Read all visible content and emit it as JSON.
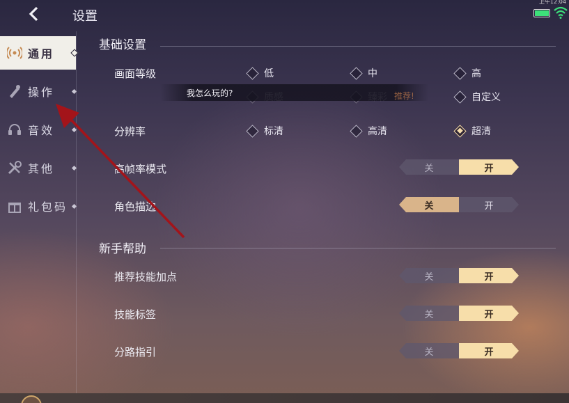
{
  "header": {
    "title": "设置",
    "time": "上午12:04"
  },
  "sidebar": {
    "items": [
      {
        "label": "通用",
        "icon": "radio-signal-icon",
        "active": true
      },
      {
        "label": "操作",
        "icon": "pen-icon",
        "active": false
      },
      {
        "label": "音效",
        "icon": "headphones-icon",
        "active": false
      },
      {
        "label": "其他",
        "icon": "tools-icon",
        "active": false
      },
      {
        "label": "礼包码",
        "icon": "gift-icon",
        "active": false
      }
    ]
  },
  "basic": {
    "title": "基础设置",
    "quality": {
      "label": "画面等级",
      "options": [
        "低",
        "中",
        "高"
      ],
      "options2": [
        "质感",
        "臻彩",
        "自定义"
      ],
      "selected": ""
    },
    "tooltip": "我怎么玩的?",
    "recommend": "推荐!",
    "resolution": {
      "label": "分辨率",
      "options": [
        "标清",
        "高清",
        "超清"
      ],
      "selected": "超清"
    },
    "high_fps": {
      "label": "高帧率模式",
      "off": "关",
      "on": "开",
      "value": "开"
    },
    "outline": {
      "label": "角色描边",
      "off": "关",
      "on": "开",
      "value": "关"
    }
  },
  "newbie": {
    "title": "新手帮助",
    "skill_points": {
      "label": "推荐技能加点",
      "off": "关",
      "on": "开",
      "value": "开"
    },
    "skill_tags": {
      "label": "技能标签",
      "off": "关",
      "on": "开",
      "value": "开"
    },
    "lane_guide": {
      "label": "分路指引",
      "off": "关",
      "on": "开",
      "value": "开"
    }
  },
  "colors": {
    "accent": "#f7deaa",
    "active_tab": "#f1efe9",
    "arrow": "#a3141a",
    "battery": "#3de07a"
  }
}
